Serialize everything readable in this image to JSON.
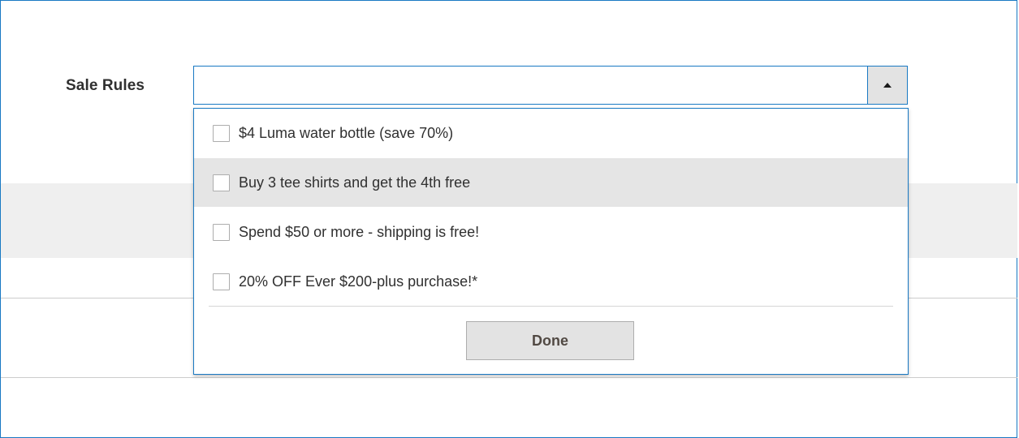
{
  "field": {
    "label": "Sale Rules",
    "value": ""
  },
  "dropdown": {
    "options": [
      {
        "label": "$4 Luma water bottle (save 70%)",
        "checked": false
      },
      {
        "label": "Buy 3 tee shirts and get the 4th free",
        "checked": false,
        "highlighted": true
      },
      {
        "label": "Spend $50 or more - shipping is free!",
        "checked": false
      },
      {
        "label": "20% OFF Ever $200-plus purchase!*",
        "checked": false
      }
    ],
    "done_label": "Done"
  },
  "colors": {
    "focus_border": "#1979c3",
    "hover_row": "#e5e5e5",
    "button_bg": "#e3e3e3"
  }
}
